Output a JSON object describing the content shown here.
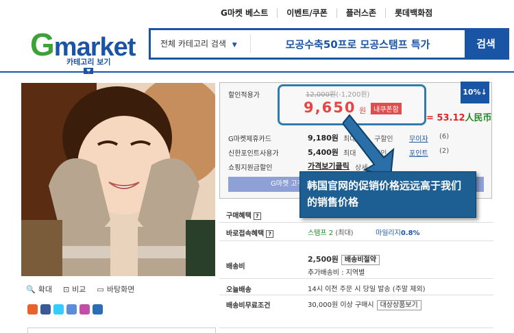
{
  "top_nav": [
    "G마켓 베스트",
    "이벤트/쿠폰",
    "플러스존",
    "롯데백화점"
  ],
  "logo": {
    "g": "G",
    "rest": "market"
  },
  "category_link": "카테고리 보기",
  "search": {
    "category": "전체 카테고리 검색",
    "query": "모공수축50프로 모공스탬프 특가",
    "button": "검색"
  },
  "tools": {
    "zoom": "확대",
    "compare": "비교",
    "wallpaper": "바탕화면"
  },
  "price": {
    "label": "할인적용가",
    "original": "12,000원",
    "discount": "(-1,200원)",
    "final": "9,650",
    "unit": "원",
    "coupon_badge": "내쿠폰함",
    "discount_badge": "10%↓",
    "rmb": "= 53.12",
    "rmb_unit": "人民币"
  },
  "cards": [
    {
      "label": "G마켓제휴카드",
      "value": "9,180원",
      "extra": "최대",
      "extra2": "구할인",
      "link": "무이자",
      "count": "(6)"
    },
    {
      "label": "신한포인트사용가",
      "value": "5,400원",
      "extra": "최대",
      "extra2": "할인",
      "link": "포인트",
      "count": "(2)"
    },
    {
      "label": "쇼핑지원금할인",
      "value": "가격보기클릭",
      "extra": "상세"
    }
  ],
  "gmarket_bar": "G마켓 고객",
  "rows": {
    "benefit": "구매혜택",
    "direct": "바로접속혜택",
    "stamp": "스탬프 2",
    "stamp_suffix": "(최대)",
    "mileage": "마일리지",
    "mileage_val": "0.8%",
    "ship_label": "배송비",
    "ship_val": "2,500원",
    "ship_btn": "배송비절약",
    "ship_extra": "추가배송비 : 지역별",
    "today_label": "오늘배송",
    "today_val": "14시 이전 주문 시 당일 발송 (주말 제외)",
    "free_label": "배송비무료조건",
    "free_val": "30,000원 이상 구매시",
    "free_btn": "대상상품보기"
  },
  "annotation": "韩国官网的促销价格远远高于我们的销售价格",
  "colors": {
    "brand_blue": "#1a55a5",
    "brand_green": "#3ba336",
    "price_red": "#e02525",
    "note_blue": "#1d5f93"
  }
}
